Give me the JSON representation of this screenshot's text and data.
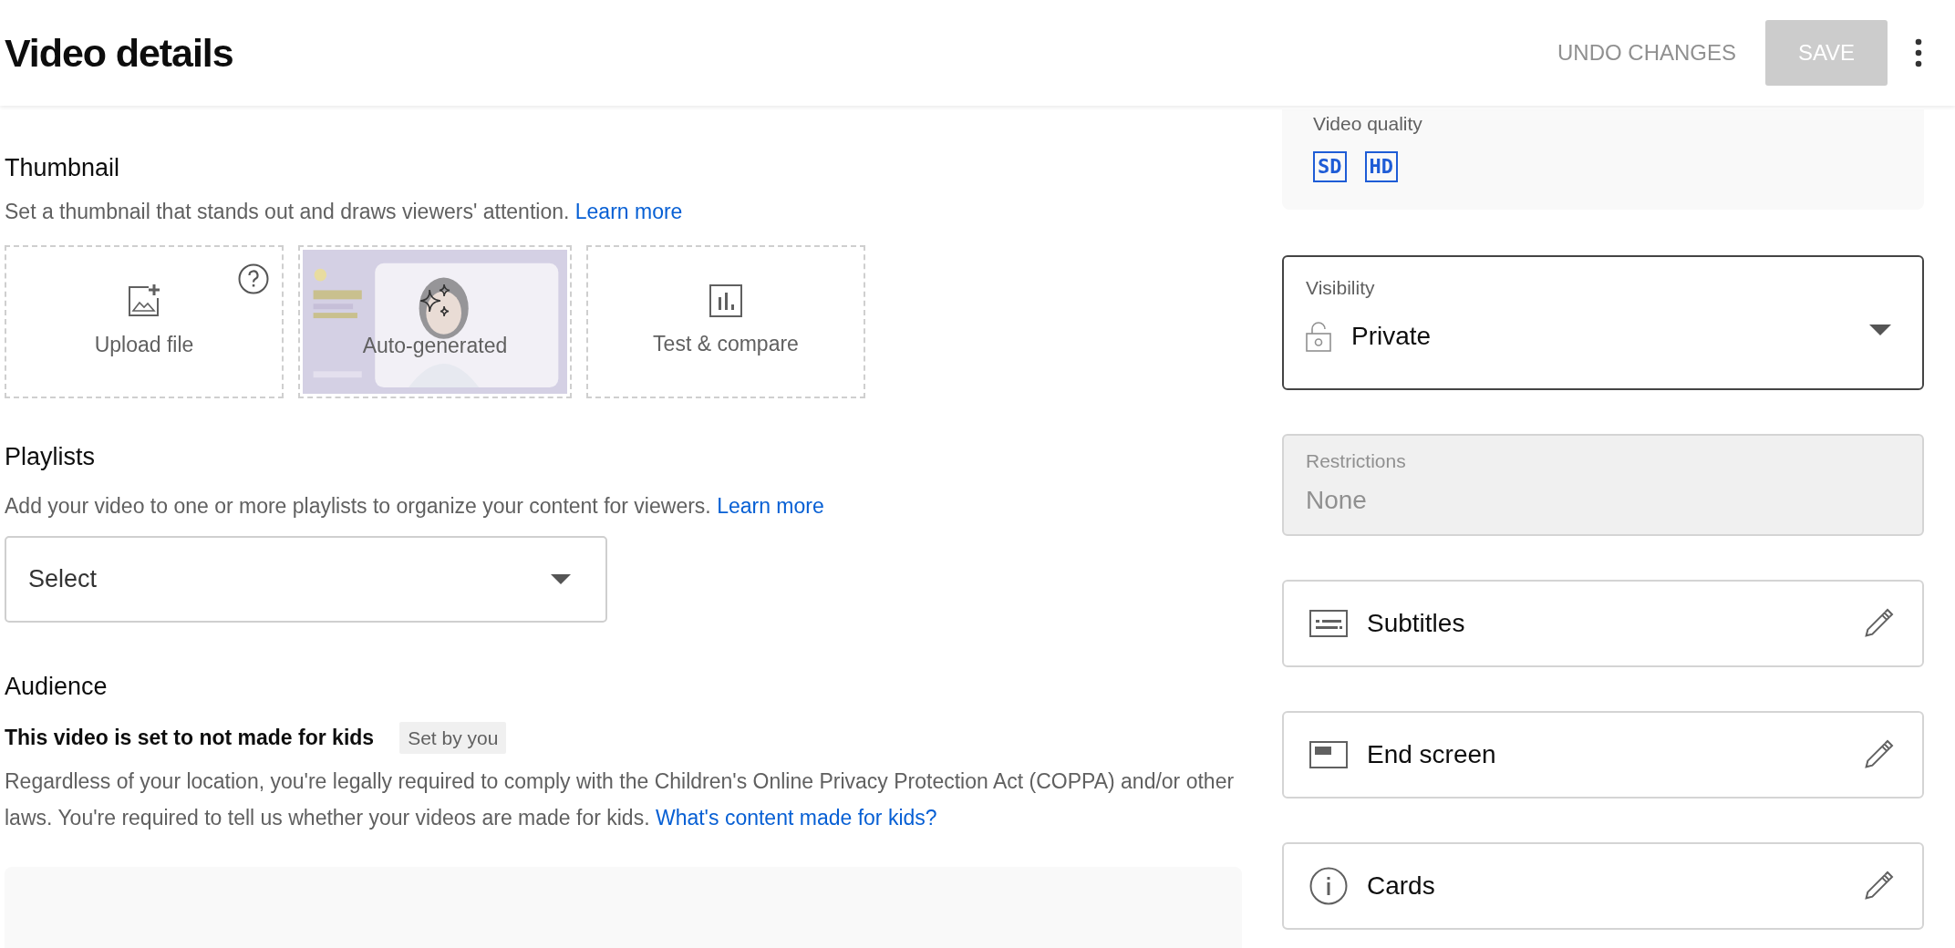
{
  "header": {
    "title": "Video details",
    "undo_button": "UNDO CHANGES",
    "save_button": {
      "label": "SAVE",
      "disabled": true
    }
  },
  "thumbnail": {
    "heading": "Thumbnail",
    "description": "Set a thumbnail that stands out and draws viewers' attention.",
    "link": "Learn more",
    "options": [
      {
        "kind": "upload",
        "label": "Upload file"
      },
      {
        "kind": "auto",
        "label": "Auto-generated"
      },
      {
        "kind": "test",
        "label": "Test & compare"
      }
    ]
  },
  "playlists": {
    "heading": "Playlists",
    "description": "Add your video to one or more playlists to organize your content for viewers.",
    "link": "Learn more",
    "select": {
      "value": "Select"
    }
  },
  "audience": {
    "heading": "Audience",
    "status": "This video is set to not made for kids",
    "badge": "Set by you",
    "description": "Regardless of your location, you're legally required to comply with the Children's Online Privacy Protection Act (COPPA) and/or other laws. You're required to tell us whether your videos are made for kids.",
    "link": "What's content made for kids?"
  },
  "video_quality": {
    "label": "Video quality",
    "badges": [
      "SD",
      "HD"
    ]
  },
  "visibility": {
    "label": "Visibility",
    "value": "Private"
  },
  "restrictions": {
    "label": "Restrictions",
    "value": "None",
    "disabled": true
  },
  "editors": [
    {
      "kind": "subtitles",
      "label": "Subtitles"
    },
    {
      "kind": "end_screen",
      "label": "End screen"
    },
    {
      "kind": "cards",
      "label": "Cards"
    }
  ]
}
